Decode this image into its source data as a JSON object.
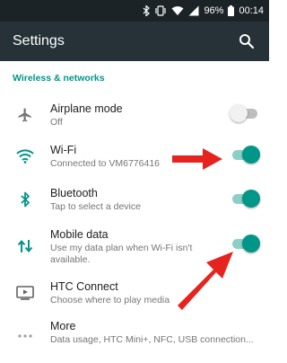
{
  "status_bar": {
    "battery_percent": "96%",
    "time": "00:14",
    "icons": [
      "bluetooth-icon",
      "vibrate-icon",
      "wifi-icon",
      "signal-icon",
      "battery-icon"
    ]
  },
  "app_bar": {
    "title": "Settings",
    "search_icon": "search-icon"
  },
  "section": {
    "header": "Wireless & networks"
  },
  "items": [
    {
      "title": "Airplane mode",
      "subtitle": "Off",
      "icon": "airplane-icon",
      "toggle": false
    },
    {
      "title": "Wi-Fi",
      "subtitle": "Connected to VM6776416",
      "icon": "wifi-icon",
      "toggle": true
    },
    {
      "title": "Bluetooth",
      "subtitle": "Tap to select a device",
      "icon": "bluetooth-icon",
      "toggle": true
    },
    {
      "title": "Mobile data",
      "subtitle": "Use my data plan when Wi-Fi isn't available.",
      "icon": "mobile-data-icon",
      "toggle": true
    },
    {
      "title": "HTC Connect",
      "subtitle": "Choose where to play media",
      "icon": "cast-icon"
    },
    {
      "title": "More",
      "subtitle": "Data usage, HTC Mini+, NFC, USB connection...",
      "icon": "more-dots-icon"
    }
  ],
  "colors": {
    "accent": "#009688",
    "toolbar": "#263238",
    "status_bar": "#1c2327",
    "annotation_arrow": "#e52420"
  }
}
